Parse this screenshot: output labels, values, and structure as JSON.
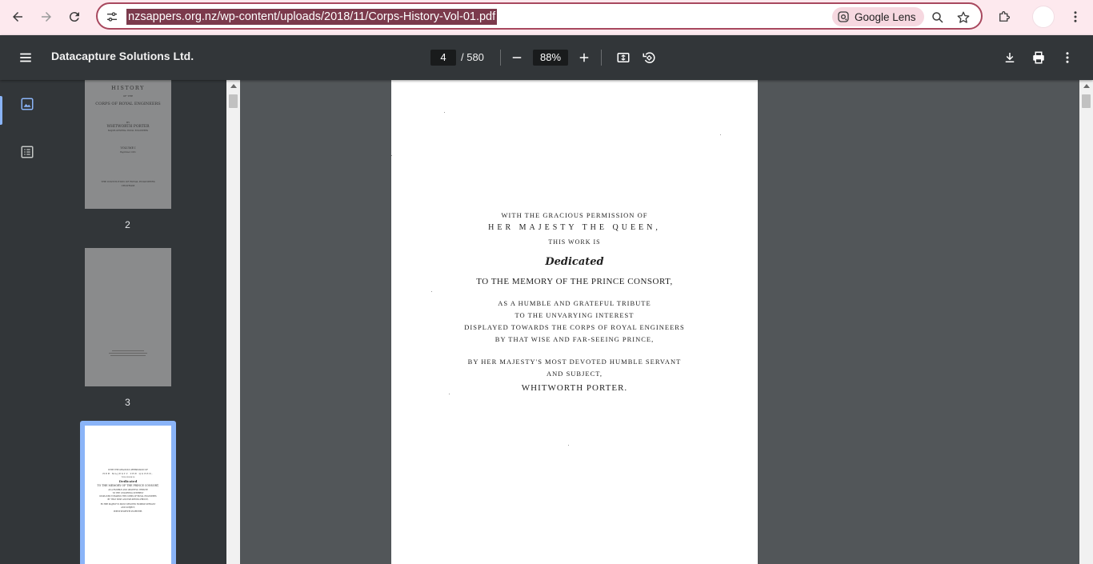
{
  "browser": {
    "url": "nzsappers.org.nz/wp-content/uploads/2018/11/Corps-History-Vol-01.pdf",
    "lens_label": "Google Lens"
  },
  "toolbar": {
    "title": "Datacapture Solutions Ltd.",
    "page_current": "4",
    "page_total": "/ 580",
    "zoom": "88%"
  },
  "thumbnails": [
    {
      "number": "2",
      "lines": [
        "HISTORY",
        "OF THE",
        "CORPS OF ROYAL ENGINEERS",
        "BY",
        "WHITWORTH PORTER",
        "MAJOR-GENERAL ROYAL ENGINEERS",
        "VOLUME I",
        "Reprinted 1951",
        "THE INSTITUTION OF ROYAL ENGINEERS",
        "CHATHAM"
      ]
    },
    {
      "number": "3"
    },
    {
      "number": ""
    }
  ],
  "page": {
    "line1": "WITH THE GRACIOUS PERMISSION OF",
    "line2": "HER MAJESTY THE QUEEN,",
    "line3": "THIS WORK IS",
    "line4": "Dedicated",
    "line5": "TO THE MEMORY OF THE PRINCE CONSORT,",
    "line6": "AS A HUMBLE AND GRATEFUL TRIBUTE",
    "line7": "TO THE UNVARYING INTEREST",
    "line8": "DISPLAYED TOWARDS THE CORPS OF ROYAL ENGINEERS",
    "line9": "BY THAT WISE AND FAR-SEEING PRINCE,",
    "line10": "BY HER MAJESTY'S MOST DEVOTED HUMBLE SERVANT",
    "line11": "AND SUBJECT,",
    "line12": "WHITWORTH PORTER."
  }
}
